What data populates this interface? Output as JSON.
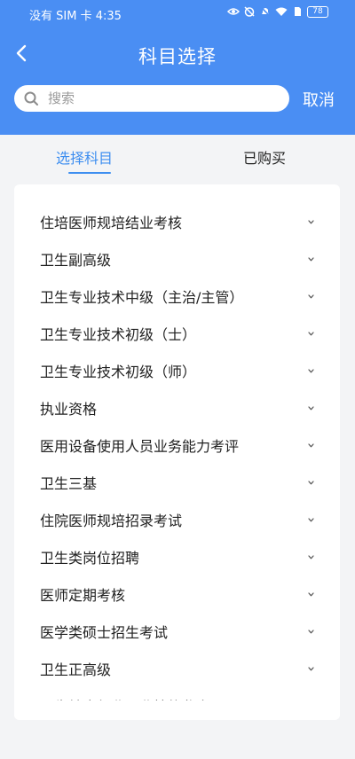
{
  "status_bar": {
    "carrier_time": "没有 SIM 卡 4:35",
    "battery": "78",
    "icons": [
      "eye-icon",
      "alarm-off-icon",
      "bell-off-icon",
      "wifi-icon",
      "sim-icon",
      "battery-icon"
    ]
  },
  "header": {
    "title": "科目选择",
    "back_icon": "chevron-left-icon",
    "bg_color": "#4a8ef3"
  },
  "search": {
    "placeholder": "搜索",
    "value": "",
    "cancel_label": "取消"
  },
  "tabs": [
    {
      "label": "选择科目",
      "active": true
    },
    {
      "label": "已购买",
      "active": false
    }
  ],
  "accent_color": "#3d8ef0",
  "subjects": [
    {
      "label": "住培医师规培结业考核"
    },
    {
      "label": "卫生副高级"
    },
    {
      "label": "卫生专业技术中级（主治/主管）"
    },
    {
      "label": "卫生专业技术初级（士）"
    },
    {
      "label": "卫生专业技术初级（师）"
    },
    {
      "label": "执业资格"
    },
    {
      "label": "医用设备使用人员业务能力考评"
    },
    {
      "label": "卫生三基"
    },
    {
      "label": "住院医师规培招录考试"
    },
    {
      "label": "卫生类岗位招聘"
    },
    {
      "label": "医师定期考核"
    },
    {
      "label": "医学类硕士招生考试"
    },
    {
      "label": "卫生正高级"
    },
    {
      "label": "卫生健康行业职业技能鉴定"
    }
  ]
}
